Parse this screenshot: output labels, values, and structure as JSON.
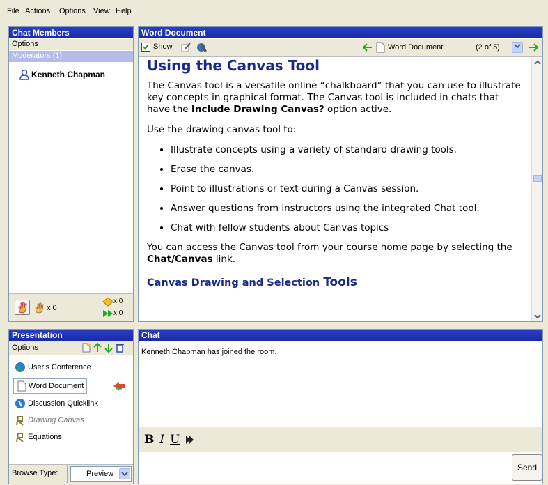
{
  "menu": {
    "items": [
      "File",
      "Actions",
      "Options",
      "View",
      "Help"
    ]
  },
  "members_panel": {
    "title": "Chat Members",
    "options_label": "Options",
    "moderators_label": "Moderators (1)",
    "member_name": "Kenneth Chapman",
    "hand_count": "x 0",
    "status_count_1": "x 0",
    "status_count_2": "x 0"
  },
  "doc_panel": {
    "title": "Word Document",
    "show_label": "Show",
    "nav_doc_name": "Word Document",
    "page_indicator": "(2 of 5)",
    "heading": "Using the Canvas Tool",
    "intro_before_bold": "The Canvas tool is a versatile online “chalkboard” that you can use to illustrate key concepts in graphical format. The Canvas tool is included in chats that have the ",
    "intro_bold": "Include Drawing Canvas?",
    "intro_after_bold": " option active.",
    "use_line": "Use the drawing canvas tool to:",
    "bullets": [
      "Illustrate concepts using a variety of standard drawing tools.",
      "Erase the canvas.",
      "Point to illustrations or text during a Canvas session.",
      "Answer questions from instructors using the integrated Chat tool.",
      "Chat with fellow students about Canvas topics"
    ],
    "access_before_bold": "You can access the Canvas tool from your course home page by selecting the ",
    "access_bold": "Chat/Canvas",
    "access_after_bold": " link.",
    "subheading_a": "Canvas Drawing and Selection ",
    "subheading_b": "Tools"
  },
  "presentation_panel": {
    "title": "Presentation",
    "options_label": "Options",
    "items": [
      {
        "label": "User's Conference",
        "icon": "globe-icon"
      },
      {
        "label": "Word Document",
        "icon": "document-icon"
      },
      {
        "label": "Discussion Quicklink",
        "icon": "link-icon"
      },
      {
        "label": "Drawing Canvas",
        "icon": "canvas-icon"
      },
      {
        "label": "Equations",
        "icon": "equation-icon"
      }
    ],
    "browse_label": "Browse Type:",
    "browse_value": "Preview"
  },
  "chat_panel": {
    "title": "Chat",
    "message": "Kenneth Chapman has joined the room.",
    "bold_label": "B",
    "italic_label": "I",
    "underline_label": "U",
    "send_label": "Send"
  },
  "colors": {
    "title_bar": "#1b2aa6",
    "moderators_bg": "#b4bde9",
    "heading_blue": "#1a2a8c",
    "arrow_green": "#23a823"
  }
}
